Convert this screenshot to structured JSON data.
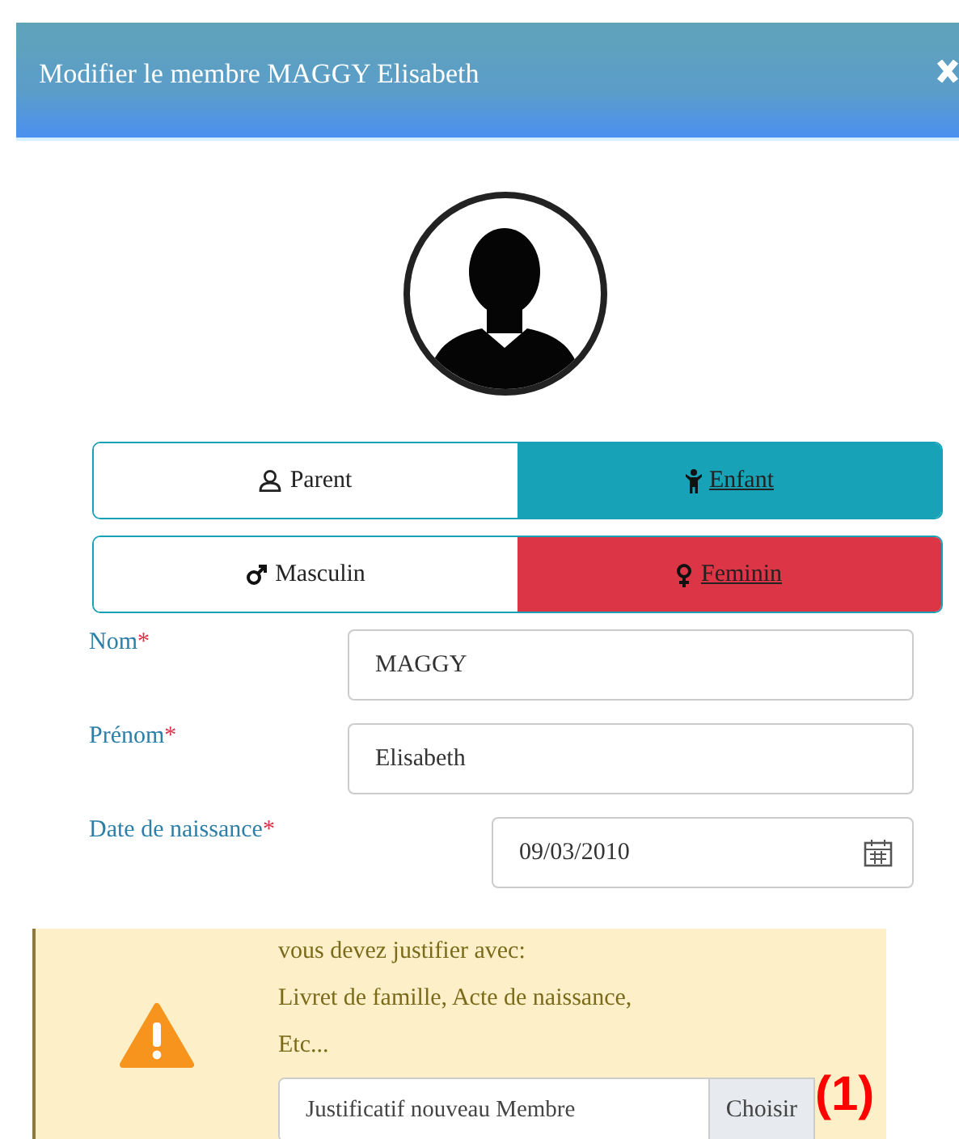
{
  "modal": {
    "title": "Modifier le membre MAGGY Elisabeth"
  },
  "toggle_groups": [
    {
      "color": "#17a2b8",
      "options": [
        {
          "label": "Parent",
          "kind": "parent",
          "selected": false
        },
        {
          "label": "Enfant",
          "kind": "child",
          "selected": true
        }
      ]
    },
    {
      "color": "#dc3545",
      "options": [
        {
          "label": "Masculin",
          "kind": "male",
          "selected": false
        },
        {
          "label": "Feminin",
          "kind": "female",
          "selected": true
        }
      ]
    }
  ],
  "fields": [
    {
      "label": "Nom",
      "marker": "*",
      "value": "MAGGY",
      "kind": "text"
    },
    {
      "label": "Prénom",
      "marker": "*",
      "value": "Elisabeth",
      "kind": "text"
    },
    {
      "label": "Date de naissance",
      "marker": "*",
      "value": "09/03/2010",
      "kind": "date"
    }
  ],
  "alert": {
    "lines": [
      "vous devez justifier avec:",
      "Livret de famille, Acte de naissance,",
      "Etc..."
    ],
    "file": {
      "placeholder": "Justificatif nouveau Membre",
      "button": "Choisir"
    }
  },
  "annotation": "(1)"
}
